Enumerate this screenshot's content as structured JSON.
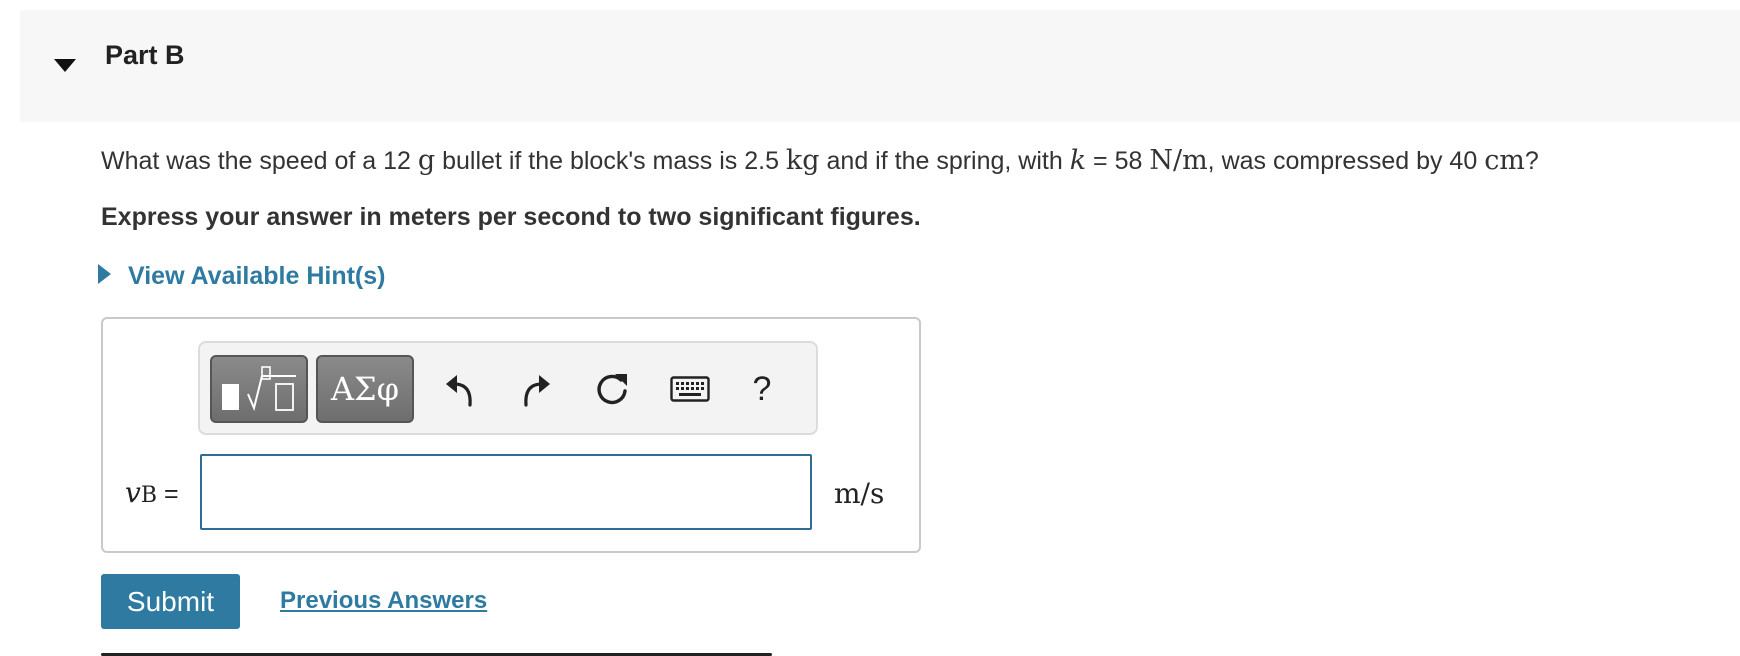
{
  "part": {
    "title": "Part B",
    "toggle_icon": "caret-down-icon"
  },
  "question": {
    "t1": "What was the speed of a 12 ",
    "u1": "g",
    "t2": " bullet if the block's mass is 2.5 ",
    "u2": "kg",
    "t3": " and if the spring, with ",
    "k": "k",
    "t4": " = 58 ",
    "u3": "N/m",
    "t5": ", was compressed by 40 ",
    "u4": "cm",
    "t6": "?"
  },
  "instruction": "Express your answer in meters per second to two significant figures.",
  "hint": {
    "label": "View Available Hint(s)",
    "icon": "caret-right-icon"
  },
  "toolbar": {
    "templates_icon": "templates-icon",
    "symbols_label": "ΑΣφ",
    "undo_icon": "undo-icon",
    "redo_icon": "redo-icon",
    "reset_icon": "reset-icon",
    "keyboard_icon": "keyboard-icon",
    "help_label": "?"
  },
  "answer": {
    "var": "v",
    "sub": "B",
    "eq": " =",
    "value": "",
    "unit": "m/s"
  },
  "actions": {
    "submit_label": "Submit",
    "previous_label": "Previous Answers"
  },
  "colors": {
    "accent": "#2e7aa0",
    "input_border": "#2e6e94",
    "header_bg": "#f7f7f7"
  }
}
